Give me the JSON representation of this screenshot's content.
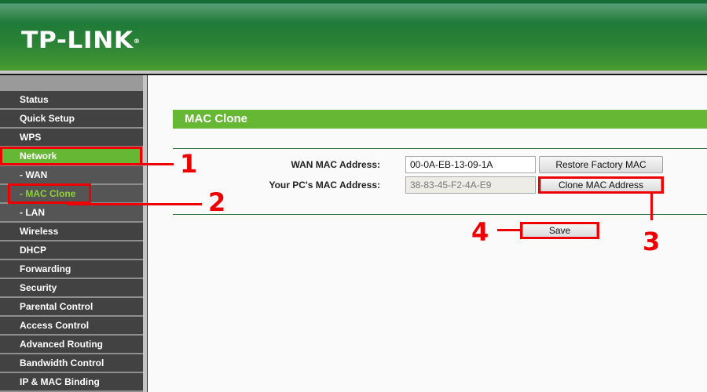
{
  "header": {
    "logo": "TP-LINK",
    "logo_mark": "®"
  },
  "sidebar": {
    "items": [
      {
        "label": "Status",
        "type": "main",
        "state": "normal"
      },
      {
        "label": "Quick Setup",
        "type": "main",
        "state": "normal"
      },
      {
        "label": "WPS",
        "type": "main",
        "state": "normal"
      },
      {
        "label": "Network",
        "type": "main",
        "state": "active"
      },
      {
        "label": "- WAN",
        "type": "sub",
        "state": "normal"
      },
      {
        "label": "- MAC Clone",
        "type": "sub",
        "state": "selected"
      },
      {
        "label": "- LAN",
        "type": "sub",
        "state": "normal"
      },
      {
        "label": "Wireless",
        "type": "main",
        "state": "normal"
      },
      {
        "label": "DHCP",
        "type": "main",
        "state": "normal"
      },
      {
        "label": "Forwarding",
        "type": "main",
        "state": "normal"
      },
      {
        "label": "Security",
        "type": "main",
        "state": "normal"
      },
      {
        "label": "Parental Control",
        "type": "main",
        "state": "normal"
      },
      {
        "label": "Access Control",
        "type": "main",
        "state": "normal"
      },
      {
        "label": "Advanced Routing",
        "type": "main",
        "state": "normal"
      },
      {
        "label": "Bandwidth Control",
        "type": "main",
        "state": "normal"
      },
      {
        "label": "IP & MAC Binding",
        "type": "main",
        "state": "normal"
      }
    ]
  },
  "main": {
    "title": "MAC Clone",
    "wan_mac_label": "WAN MAC Address:",
    "wan_mac_value": "00-0A-EB-13-09-1A",
    "pc_mac_label": "Your PC's MAC Address:",
    "pc_mac_value": "38-83-45-F2-4A-E9",
    "restore_button": "Restore Factory MAC",
    "clone_button": "Clone MAC Address",
    "save_button": "Save"
  },
  "annotations": {
    "step1": "1",
    "step2": "2",
    "step3": "3",
    "step4": "4"
  },
  "colors": {
    "brand_green": "#66b733",
    "header_green": "#1f7a38",
    "annotation_red": "#ee0000"
  }
}
